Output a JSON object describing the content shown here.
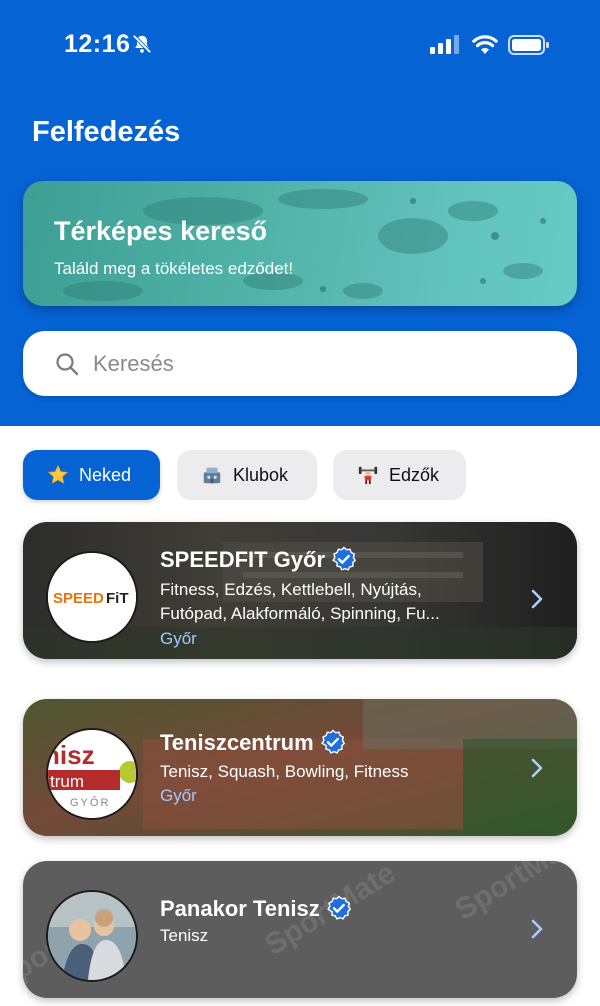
{
  "status_bar": {
    "time": "12:16"
  },
  "page_title": "Felfedezés",
  "map_card": {
    "title": "Térképes kereső",
    "subtitle": "Találd meg a tökéletes edződet!"
  },
  "search": {
    "placeholder": "Keresés"
  },
  "tabs": [
    {
      "label": "Neked",
      "icon": "star-icon",
      "active": true
    },
    {
      "label": "Klubok",
      "icon": "stadium-icon",
      "active": false
    },
    {
      "label": "Edzők",
      "icon": "weightlifter-icon",
      "active": false
    }
  ],
  "cards": [
    {
      "title": "SPEEDFIT Győr",
      "verified": true,
      "tags_line1": "Fitness, Edzés, Kettlebell, Nyújtás,",
      "tags_line2": "Futópad, Alakformáló, Spinning, Fu...",
      "city": "Győr",
      "logo_text_a": "SPEED",
      "logo_text_b": "FiT"
    },
    {
      "title": "Teniszcentrum",
      "verified": true,
      "tags_line1": "Tenisz, Squash, Bowling, Fitness",
      "city": "Győr",
      "logo_text_a": "nisz",
      "logo_text_b": "trum",
      "logo_text_c": "GYŐR"
    },
    {
      "title": "Panakor Tenisz",
      "verified": true,
      "tags_line1": "Tenisz",
      "watermark": "SportMate"
    }
  ],
  "colors": {
    "brand_blue": "#0563d4",
    "city_link": "#9ec9ff"
  }
}
